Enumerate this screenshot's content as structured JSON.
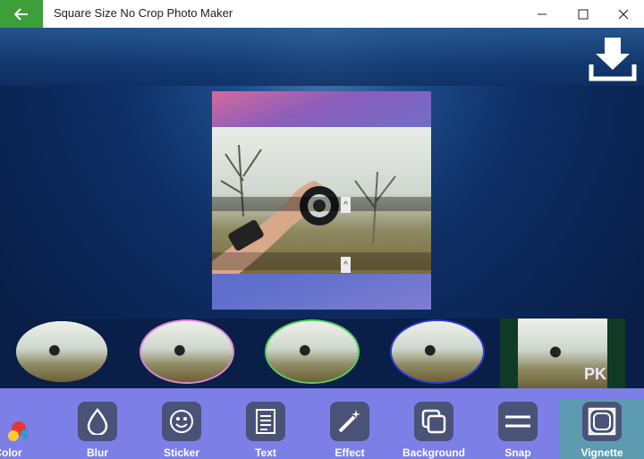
{
  "window": {
    "title": "Square Size No Crop Photo Maker",
    "back_icon": "arrow-left-icon",
    "minimize": "—",
    "maximize": "☐",
    "close": "✕"
  },
  "toolbar": {
    "items": [
      {
        "label": "Color",
        "icon": "palette-icon"
      },
      {
        "label": "Blur",
        "icon": "drop-icon"
      },
      {
        "label": "Sticker",
        "icon": "smiley-icon"
      },
      {
        "label": "Text",
        "icon": "document-icon"
      },
      {
        "label": "Effect",
        "icon": "magic-wand-icon"
      },
      {
        "label": "Background",
        "icon": "layers-icon"
      },
      {
        "label": "Snap",
        "icon": "equals-icon"
      },
      {
        "label": "Vignette",
        "icon": "vignette-icon"
      }
    ],
    "active": "Vignette"
  },
  "thumbnails": [
    "vignette-oval-plain",
    "vignette-oval-pink",
    "vignette-oval-green",
    "vignette-oval-blue",
    "vignette-square"
  ],
  "watermark": "PK",
  "colors": {
    "accent_green": "#3d9f3a",
    "toolbar_bg": "#7b7fe6",
    "icon_bg": "#4a5277"
  }
}
